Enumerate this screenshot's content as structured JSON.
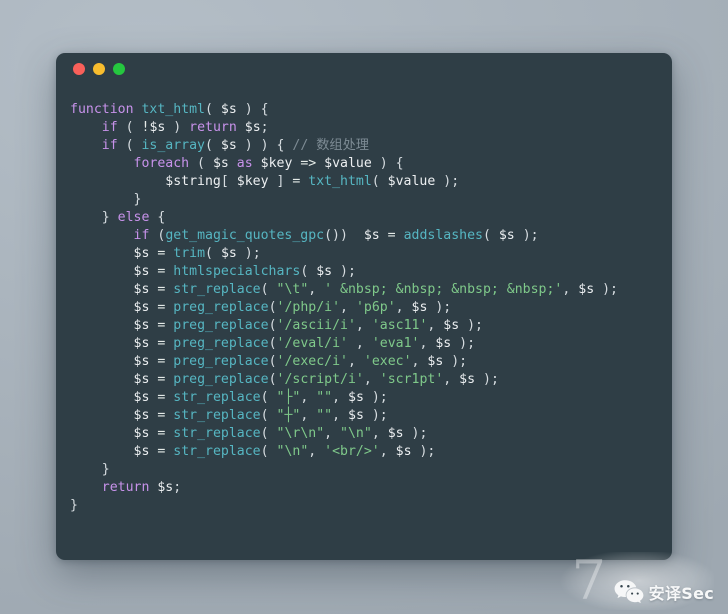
{
  "window": {
    "traffic_lights": [
      {
        "name": "close-button",
        "color": "#f9605a",
        "label": "close"
      },
      {
        "name": "minimize-button",
        "color": "#f8bd2e",
        "label": "minimize"
      },
      {
        "name": "maximize-button",
        "color": "#25c73f",
        "label": "maximize"
      }
    ],
    "background_color": "#2f3e46"
  },
  "code": {
    "language": "php",
    "lines": [
      [
        {
          "t": "function ",
          "c": "kw"
        },
        {
          "t": "txt_html",
          "c": "fn"
        },
        {
          "t": "( ",
          "c": "pun"
        },
        {
          "t": "$s",
          "c": "var"
        },
        {
          "t": " ) {",
          "c": "pun"
        }
      ],
      [
        {
          "t": "    ",
          "c": "pun"
        },
        {
          "t": "if",
          "c": "kw"
        },
        {
          "t": " ( ",
          "c": "pun"
        },
        {
          "t": "!",
          "c": "op"
        },
        {
          "t": "$s",
          "c": "var"
        },
        {
          "t": " ) ",
          "c": "pun"
        },
        {
          "t": "return",
          "c": "kw"
        },
        {
          "t": " ",
          "c": "pun"
        },
        {
          "t": "$s",
          "c": "var"
        },
        {
          "t": ";",
          "c": "pun"
        }
      ],
      [
        {
          "t": "    ",
          "c": "pun"
        },
        {
          "t": "if",
          "c": "kw"
        },
        {
          "t": " ( ",
          "c": "pun"
        },
        {
          "t": "is_array",
          "c": "fn"
        },
        {
          "t": "( ",
          "c": "pun"
        },
        {
          "t": "$s",
          "c": "var"
        },
        {
          "t": " ) ) { ",
          "c": "pun"
        },
        {
          "t": "// 数组处理",
          "c": "cmt"
        }
      ],
      [
        {
          "t": "        ",
          "c": "pun"
        },
        {
          "t": "foreach",
          "c": "kw"
        },
        {
          "t": " ( ",
          "c": "pun"
        },
        {
          "t": "$s",
          "c": "var"
        },
        {
          "t": " ",
          "c": "pun"
        },
        {
          "t": "as",
          "c": "kw"
        },
        {
          "t": " ",
          "c": "pun"
        },
        {
          "t": "$key",
          "c": "var"
        },
        {
          "t": " => ",
          "c": "op"
        },
        {
          "t": "$value",
          "c": "var"
        },
        {
          "t": " ) {",
          "c": "pun"
        }
      ],
      [
        {
          "t": "            ",
          "c": "pun"
        },
        {
          "t": "$string",
          "c": "var"
        },
        {
          "t": "[ ",
          "c": "pun"
        },
        {
          "t": "$key",
          "c": "var"
        },
        {
          "t": " ] ",
          "c": "pun"
        },
        {
          "t": "=",
          "c": "op"
        },
        {
          "t": " ",
          "c": "pun"
        },
        {
          "t": "txt_html",
          "c": "fn"
        },
        {
          "t": "( ",
          "c": "pun"
        },
        {
          "t": "$value",
          "c": "var"
        },
        {
          "t": " );",
          "c": "pun"
        }
      ],
      [
        {
          "t": "        }",
          "c": "pun"
        }
      ],
      [
        {
          "t": "    } ",
          "c": "pun"
        },
        {
          "t": "else",
          "c": "kw"
        },
        {
          "t": " {",
          "c": "pun"
        }
      ],
      [
        {
          "t": "        ",
          "c": "pun"
        },
        {
          "t": "if",
          "c": "kw"
        },
        {
          "t": " (",
          "c": "pun"
        },
        {
          "t": "get_magic_quotes_gpc",
          "c": "fn"
        },
        {
          "t": "())  ",
          "c": "pun"
        },
        {
          "t": "$s",
          "c": "var"
        },
        {
          "t": " ",
          "c": "pun"
        },
        {
          "t": "=",
          "c": "op"
        },
        {
          "t": " ",
          "c": "pun"
        },
        {
          "t": "addslashes",
          "c": "fn"
        },
        {
          "t": "( ",
          "c": "pun"
        },
        {
          "t": "$s",
          "c": "var"
        },
        {
          "t": " );",
          "c": "pun"
        }
      ],
      [
        {
          "t": "        ",
          "c": "pun"
        },
        {
          "t": "$s",
          "c": "var"
        },
        {
          "t": " ",
          "c": "pun"
        },
        {
          "t": "=",
          "c": "op"
        },
        {
          "t": " ",
          "c": "pun"
        },
        {
          "t": "trim",
          "c": "fn"
        },
        {
          "t": "( ",
          "c": "pun"
        },
        {
          "t": "$s",
          "c": "var"
        },
        {
          "t": " );",
          "c": "pun"
        }
      ],
      [
        {
          "t": "        ",
          "c": "pun"
        },
        {
          "t": "$s",
          "c": "var"
        },
        {
          "t": " ",
          "c": "pun"
        },
        {
          "t": "=",
          "c": "op"
        },
        {
          "t": " ",
          "c": "pun"
        },
        {
          "t": "htmlspecialchars",
          "c": "fn"
        },
        {
          "t": "( ",
          "c": "pun"
        },
        {
          "t": "$s",
          "c": "var"
        },
        {
          "t": " );",
          "c": "pun"
        }
      ],
      [
        {
          "t": "        ",
          "c": "pun"
        },
        {
          "t": "$s",
          "c": "var"
        },
        {
          "t": " ",
          "c": "pun"
        },
        {
          "t": "=",
          "c": "op"
        },
        {
          "t": " ",
          "c": "pun"
        },
        {
          "t": "str_replace",
          "c": "fn"
        },
        {
          "t": "( ",
          "c": "pun"
        },
        {
          "t": "\"\\t\"",
          "c": "str"
        },
        {
          "t": ", ",
          "c": "pun"
        },
        {
          "t": "' &nbsp; &nbsp; &nbsp; &nbsp;'",
          "c": "str"
        },
        {
          "t": ", ",
          "c": "pun"
        },
        {
          "t": "$s",
          "c": "var"
        },
        {
          "t": " );",
          "c": "pun"
        }
      ],
      [
        {
          "t": "        ",
          "c": "pun"
        },
        {
          "t": "$s",
          "c": "var"
        },
        {
          "t": " ",
          "c": "pun"
        },
        {
          "t": "=",
          "c": "op"
        },
        {
          "t": " ",
          "c": "pun"
        },
        {
          "t": "preg_replace",
          "c": "fn"
        },
        {
          "t": "(",
          "c": "pun"
        },
        {
          "t": "'/php/i'",
          "c": "str"
        },
        {
          "t": ", ",
          "c": "pun"
        },
        {
          "t": "'p6p'",
          "c": "str"
        },
        {
          "t": ", ",
          "c": "pun"
        },
        {
          "t": "$s",
          "c": "var"
        },
        {
          "t": " );",
          "c": "pun"
        }
      ],
      [
        {
          "t": "        ",
          "c": "pun"
        },
        {
          "t": "$s",
          "c": "var"
        },
        {
          "t": " ",
          "c": "pun"
        },
        {
          "t": "=",
          "c": "op"
        },
        {
          "t": " ",
          "c": "pun"
        },
        {
          "t": "preg_replace",
          "c": "fn"
        },
        {
          "t": "(",
          "c": "pun"
        },
        {
          "t": "'/ascii/i'",
          "c": "str"
        },
        {
          "t": ", ",
          "c": "pun"
        },
        {
          "t": "'asc11'",
          "c": "str"
        },
        {
          "t": ", ",
          "c": "pun"
        },
        {
          "t": "$s",
          "c": "var"
        },
        {
          "t": " );",
          "c": "pun"
        }
      ],
      [
        {
          "t": "        ",
          "c": "pun"
        },
        {
          "t": "$s",
          "c": "var"
        },
        {
          "t": " ",
          "c": "pun"
        },
        {
          "t": "=",
          "c": "op"
        },
        {
          "t": " ",
          "c": "pun"
        },
        {
          "t": "preg_replace",
          "c": "fn"
        },
        {
          "t": "(",
          "c": "pun"
        },
        {
          "t": "'/eval/i'",
          "c": "str"
        },
        {
          "t": " , ",
          "c": "pun"
        },
        {
          "t": "'eva1'",
          "c": "str"
        },
        {
          "t": ", ",
          "c": "pun"
        },
        {
          "t": "$s",
          "c": "var"
        },
        {
          "t": " );",
          "c": "pun"
        }
      ],
      [
        {
          "t": "        ",
          "c": "pun"
        },
        {
          "t": "$s",
          "c": "var"
        },
        {
          "t": " ",
          "c": "pun"
        },
        {
          "t": "=",
          "c": "op"
        },
        {
          "t": " ",
          "c": "pun"
        },
        {
          "t": "preg_replace",
          "c": "fn"
        },
        {
          "t": "(",
          "c": "pun"
        },
        {
          "t": "'/exec/i'",
          "c": "str"
        },
        {
          "t": ", ",
          "c": "pun"
        },
        {
          "t": "'exec'",
          "c": "str"
        },
        {
          "t": ", ",
          "c": "pun"
        },
        {
          "t": "$s",
          "c": "var"
        },
        {
          "t": " );",
          "c": "pun"
        }
      ],
      [
        {
          "t": "        ",
          "c": "pun"
        },
        {
          "t": "$s",
          "c": "var"
        },
        {
          "t": " ",
          "c": "pun"
        },
        {
          "t": "=",
          "c": "op"
        },
        {
          "t": " ",
          "c": "pun"
        },
        {
          "t": "preg_replace",
          "c": "fn"
        },
        {
          "t": "(",
          "c": "pun"
        },
        {
          "t": "'/script/i'",
          "c": "str"
        },
        {
          "t": ", ",
          "c": "pun"
        },
        {
          "t": "'scr1pt'",
          "c": "str"
        },
        {
          "t": ", ",
          "c": "pun"
        },
        {
          "t": "$s",
          "c": "var"
        },
        {
          "t": " );",
          "c": "pun"
        }
      ],
      [
        {
          "t": "        ",
          "c": "pun"
        },
        {
          "t": "$s",
          "c": "var"
        },
        {
          "t": " ",
          "c": "pun"
        },
        {
          "t": "=",
          "c": "op"
        },
        {
          "t": " ",
          "c": "pun"
        },
        {
          "t": "str_replace",
          "c": "fn"
        },
        {
          "t": "( ",
          "c": "pun"
        },
        {
          "t": "\"├\"",
          "c": "str"
        },
        {
          "t": ", ",
          "c": "pun"
        },
        {
          "t": "\"\"",
          "c": "str"
        },
        {
          "t": ", ",
          "c": "pun"
        },
        {
          "t": "$s",
          "c": "var"
        },
        {
          "t": " );",
          "c": "pun"
        }
      ],
      [
        {
          "t": "        ",
          "c": "pun"
        },
        {
          "t": "$s",
          "c": "var"
        },
        {
          "t": " ",
          "c": "pun"
        },
        {
          "t": "=",
          "c": "op"
        },
        {
          "t": " ",
          "c": "pun"
        },
        {
          "t": "str_replace",
          "c": "fn"
        },
        {
          "t": "( ",
          "c": "pun"
        },
        {
          "t": "\"┼\"",
          "c": "str"
        },
        {
          "t": ", ",
          "c": "pun"
        },
        {
          "t": "\"\"",
          "c": "str"
        },
        {
          "t": ", ",
          "c": "pun"
        },
        {
          "t": "$s",
          "c": "var"
        },
        {
          "t": " );",
          "c": "pun"
        }
      ],
      [
        {
          "t": "        ",
          "c": "pun"
        },
        {
          "t": "$s",
          "c": "var"
        },
        {
          "t": " ",
          "c": "pun"
        },
        {
          "t": "=",
          "c": "op"
        },
        {
          "t": " ",
          "c": "pun"
        },
        {
          "t": "str_replace",
          "c": "fn"
        },
        {
          "t": "( ",
          "c": "pun"
        },
        {
          "t": "\"\\r\\n\"",
          "c": "str"
        },
        {
          "t": ", ",
          "c": "pun"
        },
        {
          "t": "\"\\n\"",
          "c": "str"
        },
        {
          "t": ", ",
          "c": "pun"
        },
        {
          "t": "$s",
          "c": "var"
        },
        {
          "t": " );",
          "c": "pun"
        }
      ],
      [
        {
          "t": "        ",
          "c": "pun"
        },
        {
          "t": "$s",
          "c": "var"
        },
        {
          "t": " ",
          "c": "pun"
        },
        {
          "t": "=",
          "c": "op"
        },
        {
          "t": " ",
          "c": "pun"
        },
        {
          "t": "str_replace",
          "c": "fn"
        },
        {
          "t": "( ",
          "c": "pun"
        },
        {
          "t": "\"\\n\"",
          "c": "str"
        },
        {
          "t": ", ",
          "c": "pun"
        },
        {
          "t": "'<br/>'",
          "c": "str"
        },
        {
          "t": ", ",
          "c": "pun"
        },
        {
          "t": "$s",
          "c": "var"
        },
        {
          "t": " );",
          "c": "pun"
        }
      ],
      [
        {
          "t": "    }",
          "c": "pun"
        }
      ],
      [
        {
          "t": "    ",
          "c": "pun"
        },
        {
          "t": "return",
          "c": "kw"
        },
        {
          "t": " ",
          "c": "pun"
        },
        {
          "t": "$s",
          "c": "var"
        },
        {
          "t": ";",
          "c": "pun"
        }
      ],
      [
        {
          "t": "}",
          "c": "pun"
        }
      ]
    ]
  },
  "watermark": {
    "label": "安译Sec",
    "numeral": "7",
    "icon": "wechat-icon"
  }
}
